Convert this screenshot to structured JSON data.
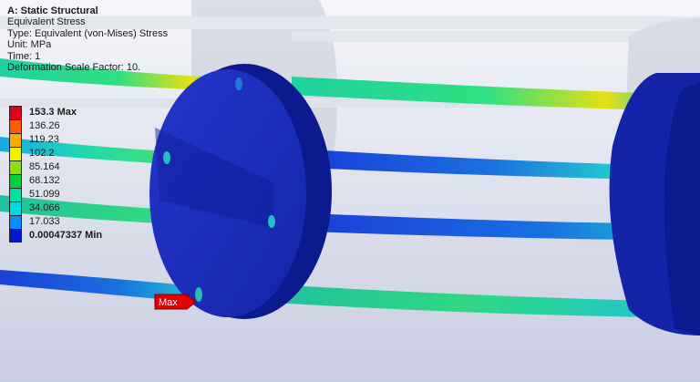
{
  "info": {
    "analysis": "A: Static Structural",
    "result": "Equivalent Stress",
    "type": "Type: Equivalent (von-Mises) Stress",
    "unit": "Unit: MPa",
    "time": "Time: 1",
    "scale": "Deformation Scale Factor: 10."
  },
  "legend": {
    "items": [
      {
        "label": "153.3 Max",
        "color": "#e0001a",
        "bold": true
      },
      {
        "label": "136.26",
        "color": "#ff5a00"
      },
      {
        "label": "119.23",
        "color": "#ffaa00"
      },
      {
        "label": "102.2",
        "color": "#f2f200"
      },
      {
        "label": "85.164",
        "color": "#8ee000"
      },
      {
        "label": "68.132",
        "color": "#00d040"
      },
      {
        "label": "51.099",
        "color": "#00e0a0"
      },
      {
        "label": "34.066",
        "color": "#00d8e0"
      },
      {
        "label": "17.033",
        "color": "#0090ff"
      },
      {
        "label": "0.00047337 Min",
        "color": "#0018d0",
        "bold": true
      }
    ]
  },
  "probe": {
    "label": "Max",
    "color": "#e00000"
  },
  "colors": {
    "disk": "#1b2fc4",
    "disk_dark": "#0d1a8f",
    "ghost_disk": "#c7cbd6",
    "background_top": "#f4f6fa",
    "background_bottom": "#c9cde0"
  }
}
